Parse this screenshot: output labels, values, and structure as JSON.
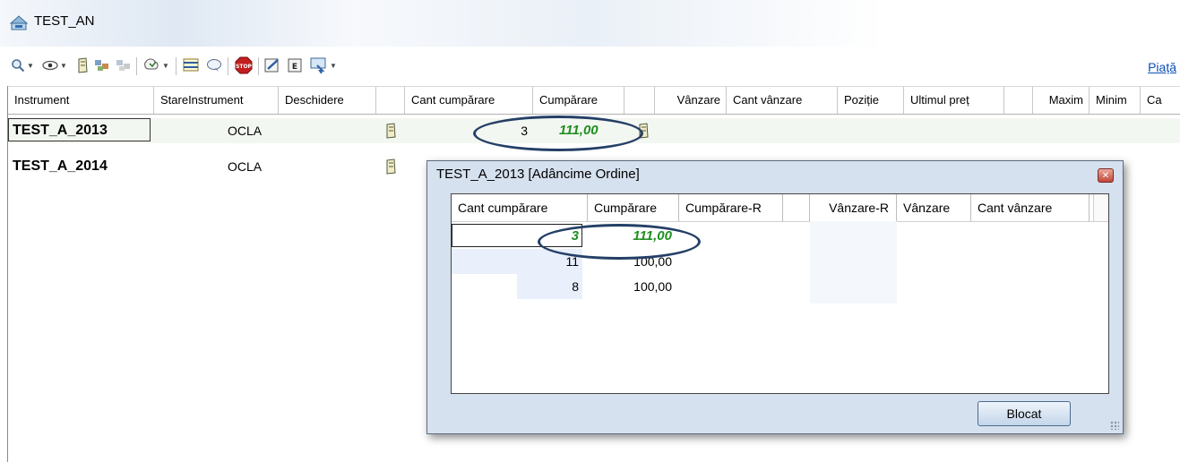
{
  "window": {
    "title": "TEST_AN"
  },
  "toolbar": {
    "market_link": "Piață",
    "icons": [
      "search-icon",
      "eye-icon",
      "instrument-icon",
      "group-icon",
      "group-disabled-icon",
      "filter-icon",
      "layout-icon",
      "chat-icon",
      "stop-icon",
      "edit-icon",
      "export-icon",
      "display-icon"
    ]
  },
  "grid": {
    "columns": [
      "Instrument",
      "StareInstrument",
      "Deschidere",
      "",
      "Cant cumpărare",
      "Cumpărare",
      "",
      "Vânzare",
      "Cant vânzare",
      "Poziție",
      "Ultimul preț",
      "",
      "Maxim",
      "Minim",
      "Ca"
    ],
    "rows": [
      {
        "instrument": "TEST_A_2013",
        "state": "OCLA",
        "buy_qty": "3",
        "buy_price": "111,00"
      },
      {
        "instrument": "TEST_A_2014",
        "state": "OCLA",
        "buy_qty": "",
        "buy_price": ""
      }
    ]
  },
  "popup": {
    "title": "TEST_A_2013 [Adâncime Ordine]",
    "columns": [
      "Cant cumpărare",
      "Cumpărare",
      "Cumpărare-R",
      "",
      "Vânzare-R",
      "Vânzare",
      "Cant vânzare"
    ],
    "rows": [
      {
        "buy_qty": "3",
        "buy_price": "111,00"
      },
      {
        "buy_qty": "11",
        "buy_price": "100,00"
      },
      {
        "buy_qty": "8",
        "buy_price": "100,00"
      }
    ],
    "depth_fill": [
      0.0,
      1.0,
      0.5
    ],
    "button_label": "Blocat"
  },
  "colors": {
    "highlight_green": "#1f8f1f",
    "annotation_oval": "#243f66",
    "popup_frame": "#d5e1ee"
  }
}
